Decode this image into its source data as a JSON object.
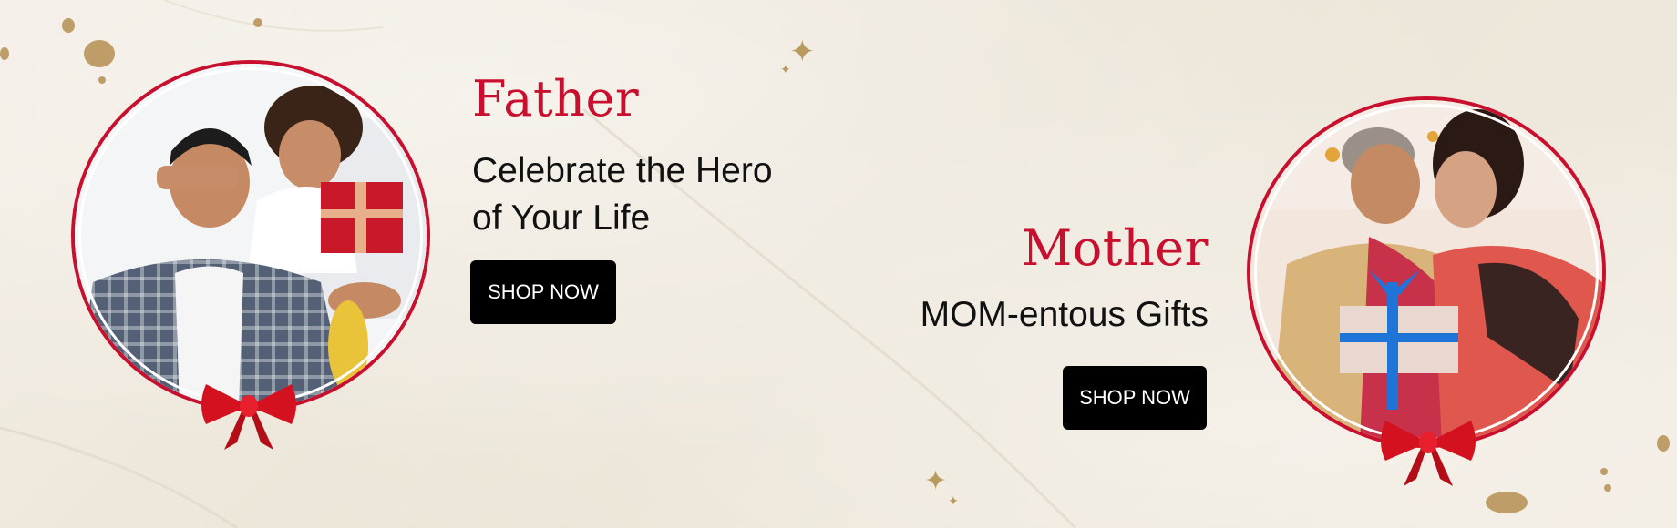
{
  "father": {
    "heading": "Father",
    "subtitle_line1": "Celebrate the Hero",
    "subtitle_line2": "of Your Life",
    "button_label": "SHOP NOW"
  },
  "mother": {
    "heading": "Mother",
    "subtitle": "MOM-entous Gifts",
    "button_label": "SHOP NOW"
  },
  "colors": {
    "accent_red": "#c8102e",
    "button_bg": "#000000",
    "gold": "#b89a5e",
    "paper": "#efe9de"
  },
  "icons": {
    "decoration": [
      "sparkle-icon",
      "ribbon-bow-icon",
      "gold-foil-blot"
    ]
  }
}
